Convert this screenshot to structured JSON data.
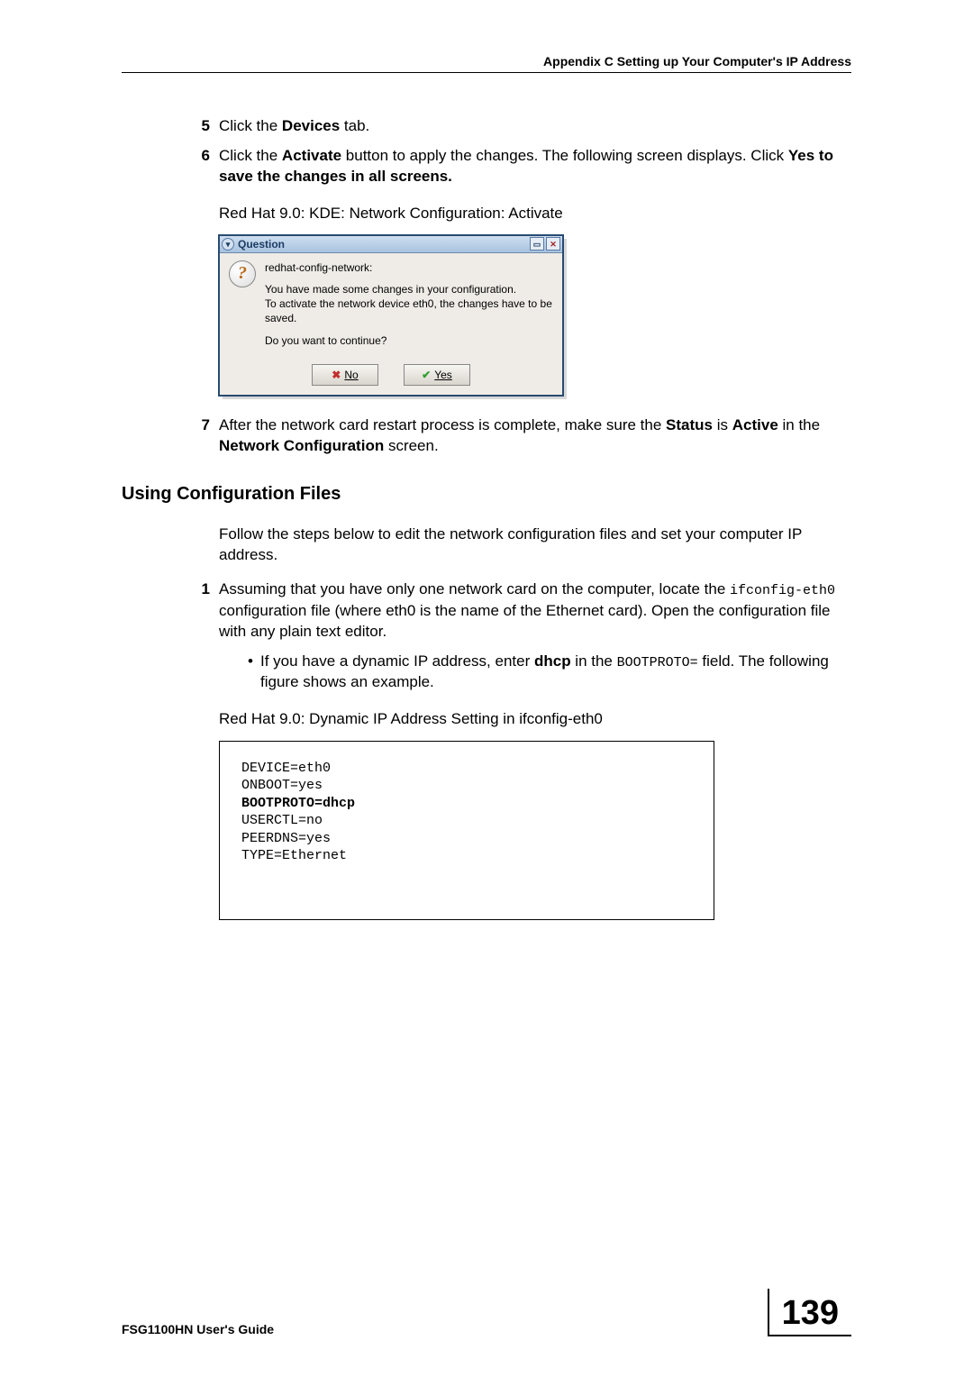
{
  "header": {
    "appendix": "Appendix C Setting up Your Computer's IP Address"
  },
  "steps": {
    "s5": {
      "num": "5",
      "pre": "Click the ",
      "bold": "Devices",
      "post": " tab."
    },
    "s6": {
      "num": "6",
      "pre": "Click the ",
      "bold1": "Activate",
      "mid": " button to apply the changes. The following screen displays. Click ",
      "bold2": "Yes to save the changes in all screens."
    },
    "caption1": "Red Hat 9.0: KDE: Network Configuration: Activate",
    "s7": {
      "num": "7",
      "pre": "After the network card restart process is complete, make sure the ",
      "bold1": "Status",
      "mid": " is ",
      "bold2": "Active",
      "mid2": " in the ",
      "bold3": "Network Configuration",
      "post": " screen."
    }
  },
  "dialog": {
    "title": "Question",
    "line1": "redhat-config-network:",
    "line2": "You have made some changes in your configuration.",
    "line3": "To activate the network device eth0, the changes have to be saved.",
    "line4": "Do you want to continue?",
    "no": "No",
    "yes": "Yes"
  },
  "section_title": "Using Configuration Files",
  "intro": "Follow the steps below to edit the network configuration files and set your computer IP address.",
  "sub": {
    "num": "1",
    "pre": "Assuming that you have only one network card on the computer, locate the ",
    "mono": "ifconfig-eth0",
    "post": " configuration file (where eth0 is the name of the Ethernet card). Open the configuration file with any plain text editor."
  },
  "bullet": {
    "pre": "If you have a dynamic IP address, enter ",
    "bold": "dhcp",
    "mid": " in the ",
    "mono": "BOOTPROTO=",
    "post": " field. The following figure shows an example."
  },
  "caption2": "Red Hat 9.0: Dynamic IP Address Setting in ifconfig-eth0",
  "code": {
    "l1": "DEVICE=eth0",
    "l2": "ONBOOT=yes",
    "l3": "BOOTPROTO=dhcp",
    "l4": "USERCTL=no",
    "l5": "PEERDNS=yes",
    "l6": "TYPE=Ethernet"
  },
  "footer": {
    "guide": "FSG1100HN User's Guide",
    "page": "139"
  }
}
